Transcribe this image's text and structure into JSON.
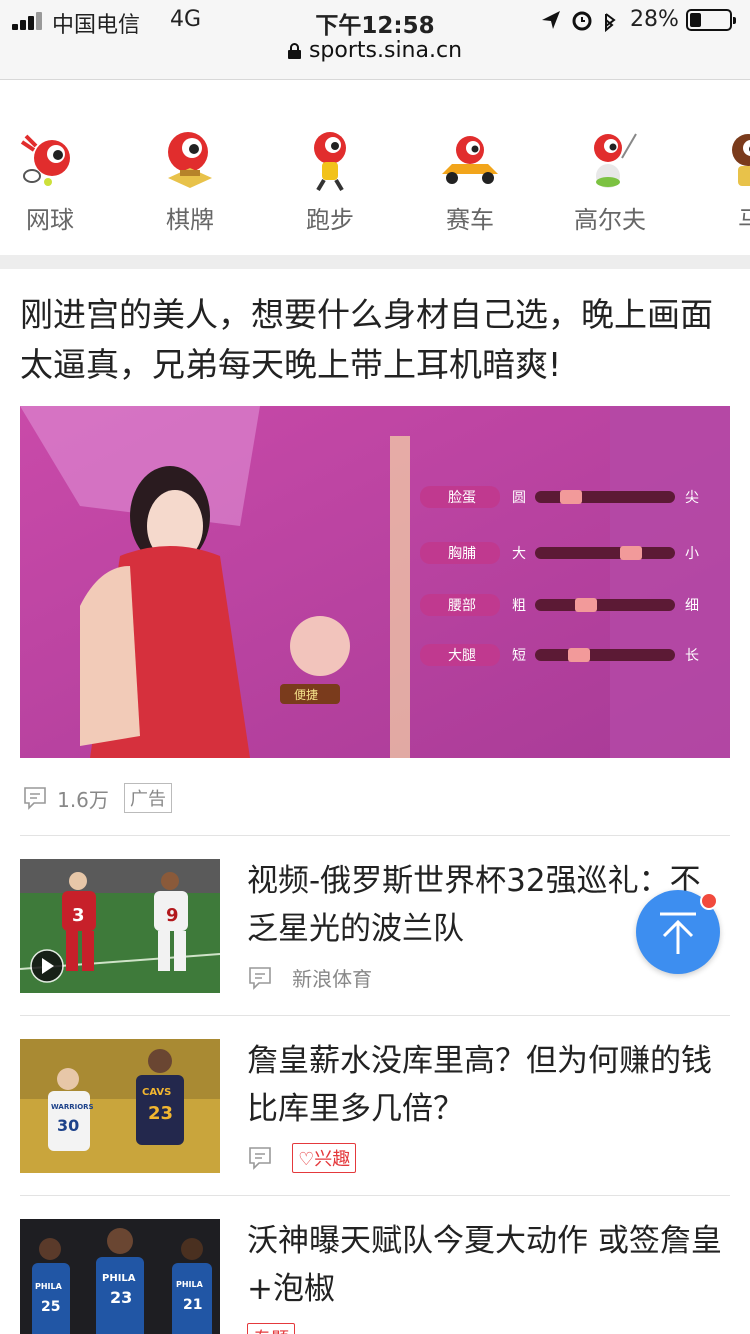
{
  "status_bar": {
    "carrier": "中国电信",
    "network": "4G",
    "time": "下午12:58",
    "battery": "28%"
  },
  "browser": {
    "url": "sports.sina.cn"
  },
  "categories": [
    {
      "label": "网球",
      "icon": "tennis-mascot-icon"
    },
    {
      "label": "棋牌",
      "icon": "chess-mascot-icon"
    },
    {
      "label": "跑步",
      "icon": "running-mascot-icon"
    },
    {
      "label": "赛车",
      "icon": "racing-mascot-icon"
    },
    {
      "label": "高尔夫",
      "icon": "golf-mascot-icon"
    },
    {
      "label": "马",
      "icon": "horse-mascot-icon"
    }
  ],
  "ad_article": {
    "title": "刚进宫的美人，想要什么身材自己选，晚上画面太逼真，兄弟每天晚上带上耳机暗爽!",
    "image_labels": [
      "脸蛋",
      "胸脯",
      "腰部",
      "大腿"
    ],
    "image_left": [
      "圆",
      "大",
      "粗",
      "短"
    ],
    "image_right": [
      "尖",
      "小",
      "细",
      "长"
    ],
    "image_button": "便捷",
    "comment_count": "1.6万",
    "ad_tag": "广告"
  },
  "news": [
    {
      "title": "视频-俄罗斯世界杯32强巡礼：不乏星光的波兰队",
      "source": "新浪体育",
      "has_video": true,
      "jersey_numbers": [
        "3",
        "9"
      ]
    },
    {
      "title": "詹皇薪水没库里高？但为何赚的钱比库里多几倍？",
      "tag": "♡兴趣",
      "jersey_numbers": [
        "30",
        "23"
      ],
      "jersey_text": [
        "WARRIORS",
        "CAVS"
      ]
    },
    {
      "title": "沃神曝天赋队今夏大动作 或签詹皇+泡椒",
      "tag": "专题",
      "jersey_numbers": [
        "25",
        "23",
        "21"
      ],
      "jersey_text": [
        "PHILA",
        "PHILA",
        "PHILA"
      ]
    }
  ],
  "colors": {
    "accent_blue": "#3d8ef0",
    "tag_red": "#e4393c",
    "badge_red": "#f14a3d"
  }
}
